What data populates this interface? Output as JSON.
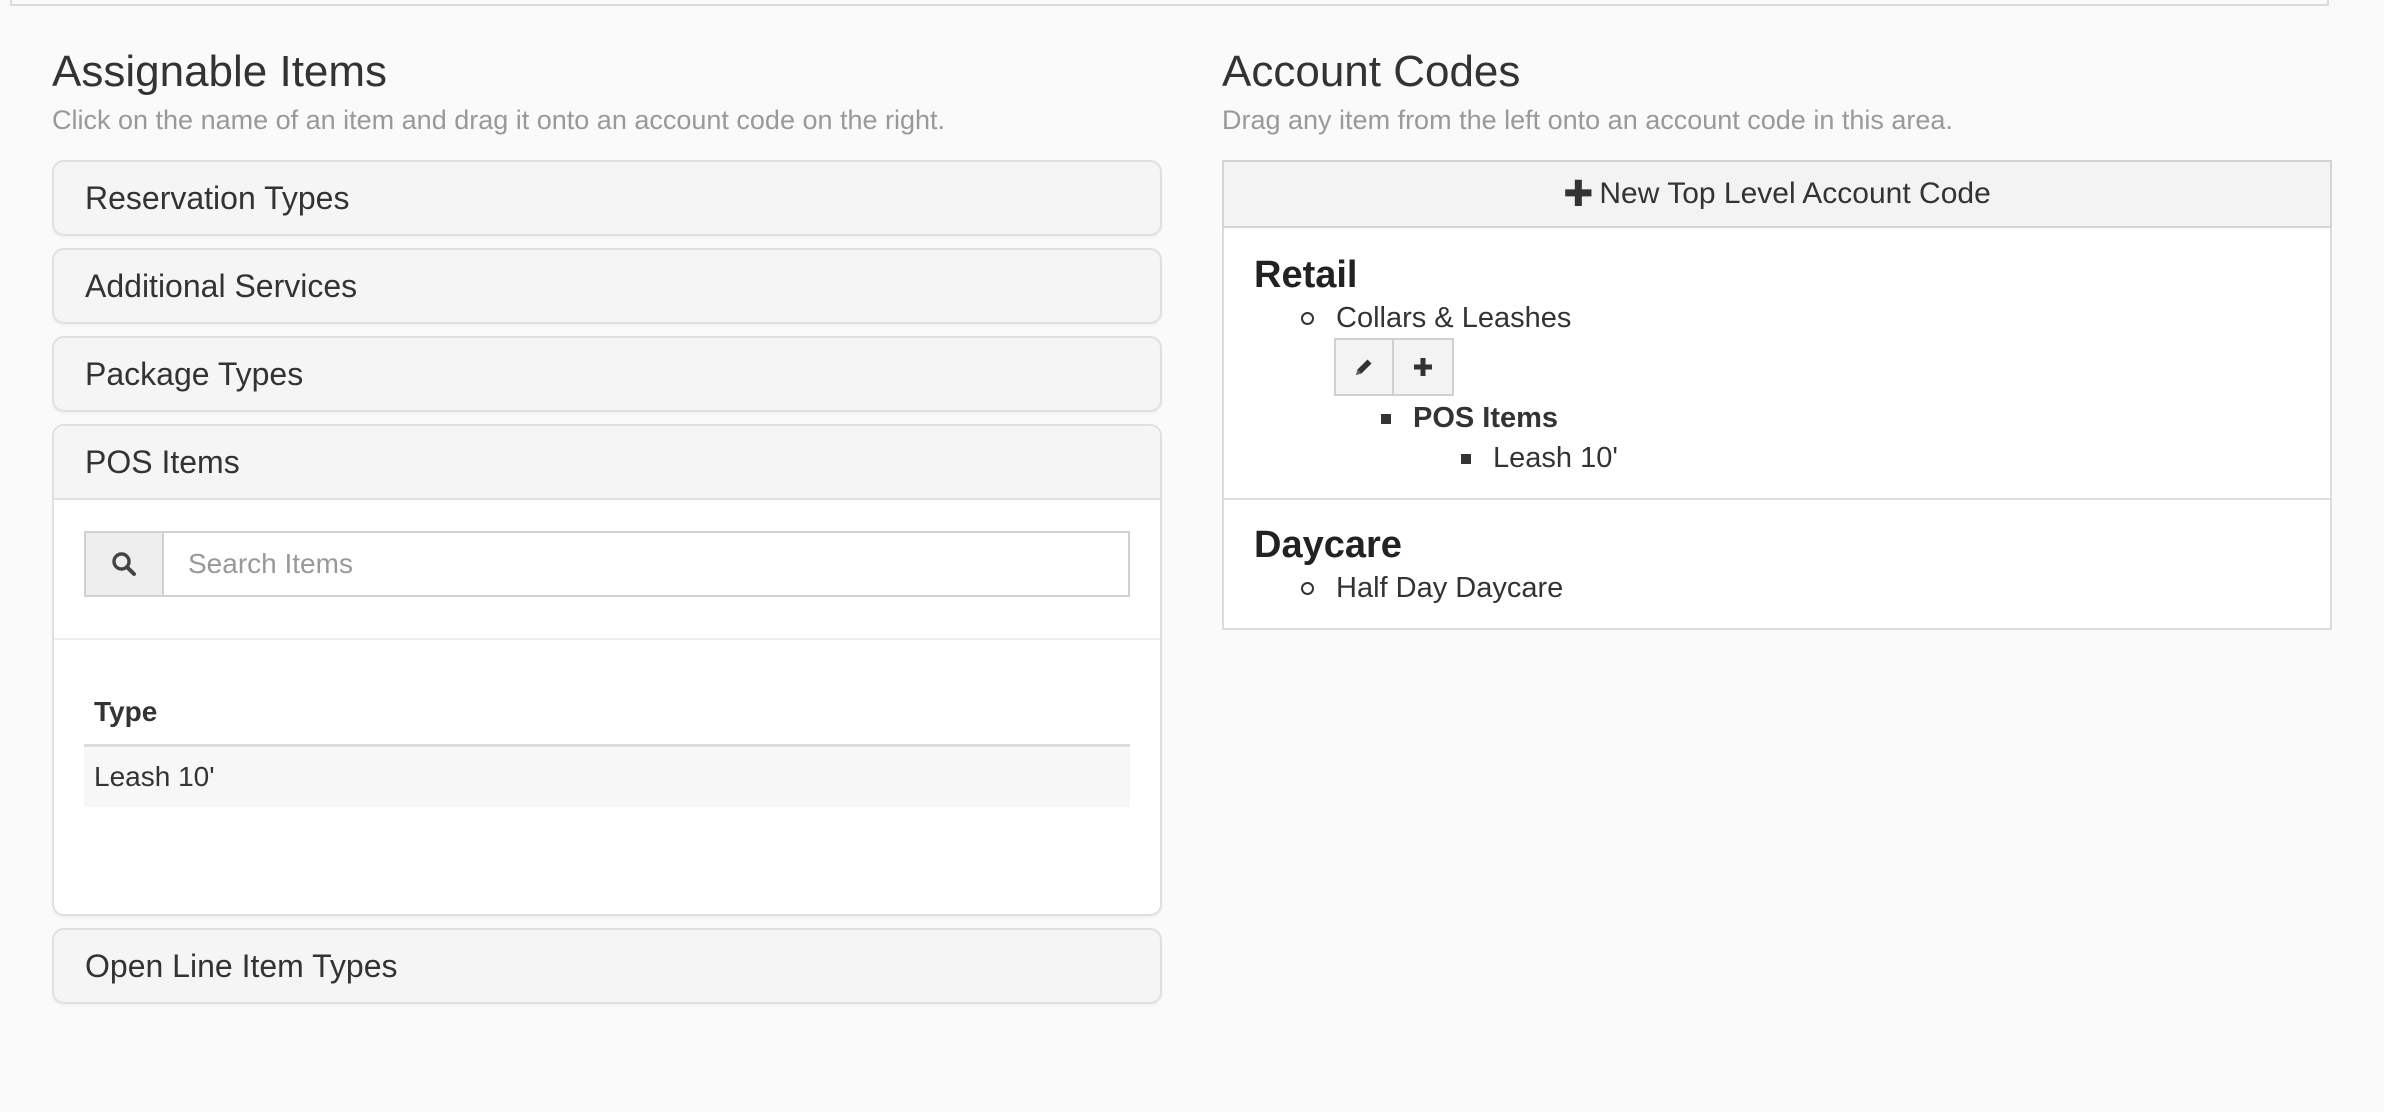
{
  "left": {
    "title": "Assignable Items",
    "subtitle": "Click on the name of an item and drag it onto an account code on the right.",
    "panels": [
      {
        "label": "Reservation Types"
      },
      {
        "label": "Additional Services"
      },
      {
        "label": "Package Types"
      },
      {
        "label": "POS Items"
      },
      {
        "label": "Open Line Item Types"
      }
    ],
    "search": {
      "placeholder": "Search Items",
      "value": "",
      "icon": "search-icon"
    },
    "table": {
      "header": "Type",
      "rows": [
        "Leash 10'"
      ]
    }
  },
  "right": {
    "title": "Account Codes",
    "subtitle": "Drag any item from the left onto an account code in this area.",
    "new_button_label": "New Top Level Account Code",
    "groups": [
      {
        "title": "Retail",
        "item": "Collars & Leashes",
        "actions": [
          "pencil-icon",
          "plus-icon"
        ],
        "subgroup": "POS Items",
        "subitem": "Leash 10'"
      },
      {
        "title": "Daycare",
        "item": "Half Day Daycare"
      }
    ]
  }
}
